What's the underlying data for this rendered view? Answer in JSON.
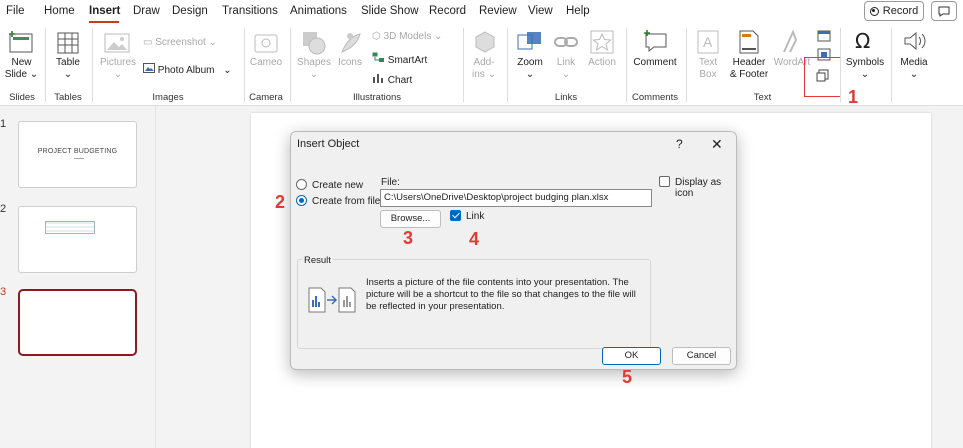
{
  "menu": {
    "tabs": [
      "File",
      "Home",
      "Insert",
      "Draw",
      "Design",
      "Transitions",
      "Animations",
      "Slide Show",
      "Record",
      "Review",
      "View",
      "Help"
    ],
    "active_tab": "Insert",
    "record_label": "Record"
  },
  "ribbon": {
    "groups": {
      "slides": "Slides",
      "tables": "Tables",
      "images": "Images",
      "camera": "Camera",
      "illustrations": "Illustrations",
      "links": "Links",
      "comments": "Comments",
      "text": "Text"
    },
    "new_slide": "New",
    "new_slide_2": "Slide",
    "table": "Table",
    "pictures": "Pictures",
    "screenshot": "Screenshot",
    "photo_album": "Photo Album",
    "cameo": "Cameo",
    "shapes": "Shapes",
    "icons": "Icons",
    "models_3d": "3D Models",
    "smartart": "SmartArt",
    "chart": "Chart",
    "addins_1": "Add-",
    "addins_2": "ins",
    "zoom": "Zoom",
    "link": "Link",
    "action": "Action",
    "comment": "Comment",
    "text_box_1": "Text",
    "text_box_2": "Box",
    "header_footer_1": "Header",
    "header_footer_2": "& Footer",
    "wordart": "WordArt",
    "symbols": "Symbols",
    "media": "Media"
  },
  "slides": [
    {
      "number": "1",
      "title": "PROJECT BUDGETING"
    },
    {
      "number": "2",
      "title": ""
    },
    {
      "number": "3",
      "title": ""
    }
  ],
  "dialog": {
    "title": "Insert Object",
    "help": "?",
    "close": "✕",
    "create_new": "Create new",
    "create_from_file": "Create from file",
    "selected_option": "Create from file",
    "file_label": "File:",
    "file_path": "C:\\Users\\OneDrive\\Desktop\\project budging plan.xlsx",
    "browse": "Browse...",
    "link_label": "Link",
    "link_checked": true,
    "display_as_icon": "Display as icon",
    "display_as_icon_checked": false,
    "result_label": "Result",
    "result_text": "Inserts a picture of the file contents into your presentation. The picture will be a shortcut to the file so that changes to the file will be reflected in your presentation.",
    "ok": "OK",
    "cancel": "Cancel"
  },
  "callouts": {
    "c1": "1",
    "c2": "2",
    "c3": "3",
    "c4": "4",
    "c5": "5"
  },
  "colors": {
    "accent": "#c43e1c",
    "callout": "#e53935",
    "selected_slide_border": "#8b1a24",
    "dialog_accent": "#0067c0"
  }
}
